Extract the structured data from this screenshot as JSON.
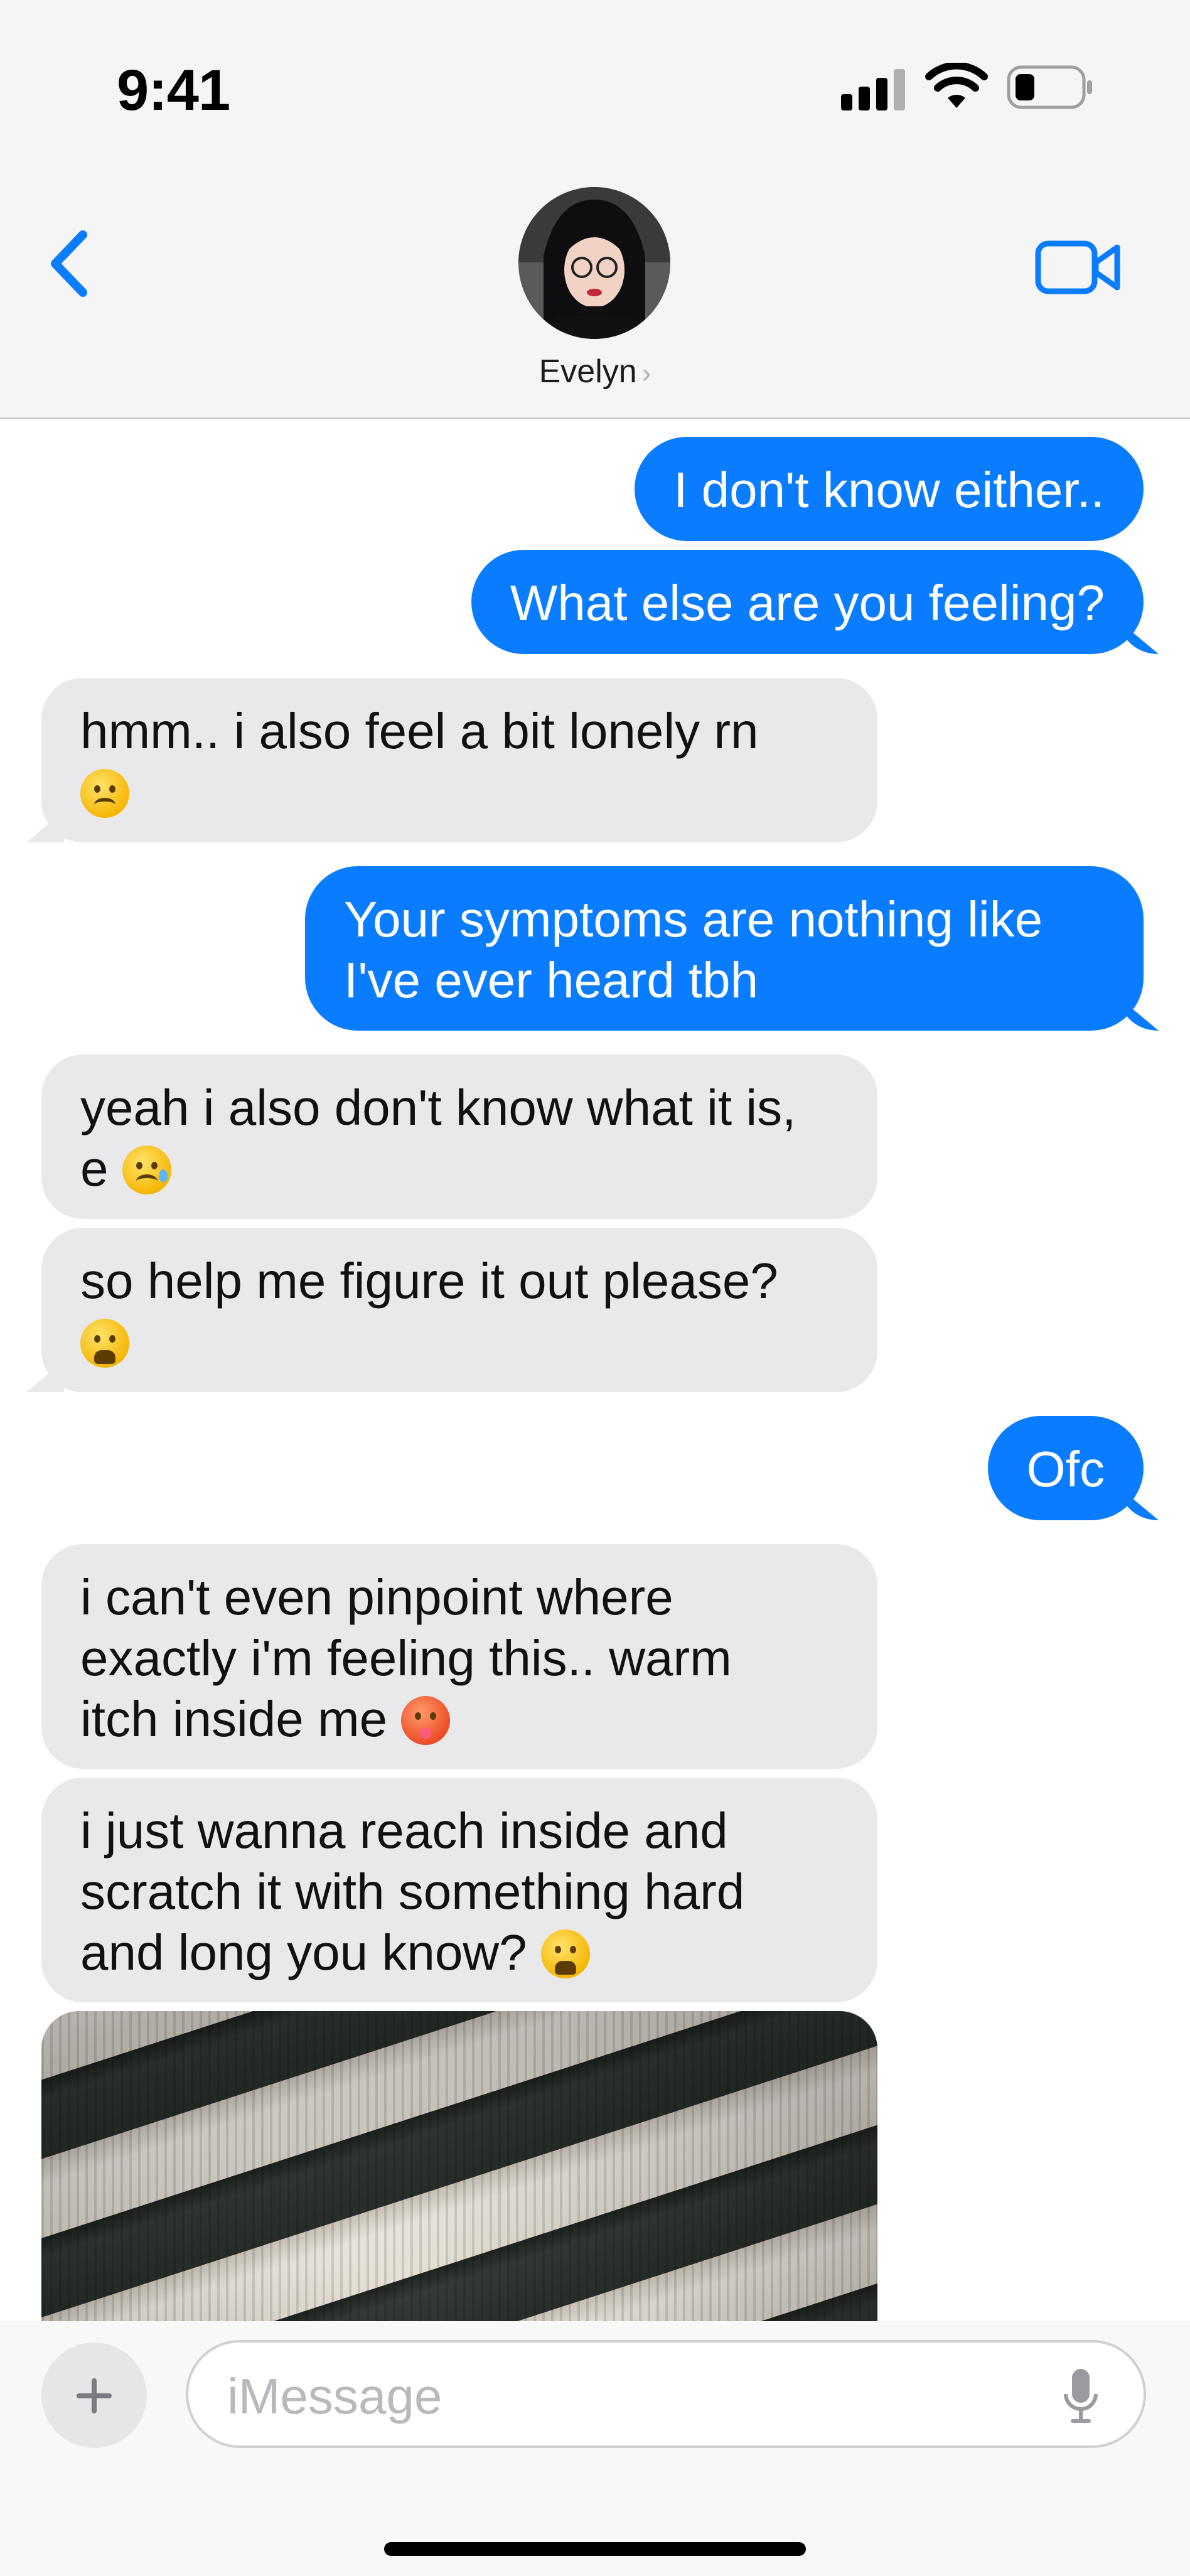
{
  "status_bar": {
    "time": "9:41"
  },
  "header": {
    "contact_name": "Evelyn",
    "name_chevron": "›"
  },
  "messages": [
    {
      "side": "out",
      "text": "I don't know either.."
    },
    {
      "side": "out",
      "text": "What else are you feeling?"
    },
    {
      "side": "in",
      "text": "hmm.. i also feel a bit lonely rn",
      "emoji": "frowning-face"
    },
    {
      "side": "out",
      "line1": "Your symptoms are nothing like",
      "line2": "I've ever heard tbh"
    },
    {
      "side": "in",
      "line1": "yeah i also don't know what it is,",
      "line2": "e",
      "emoji": "crying-face"
    },
    {
      "side": "in",
      "text": "so help me figure it out please?",
      "emoji": "weary-face"
    },
    {
      "side": "out",
      "text": "Ofc"
    },
    {
      "side": "in",
      "line1": "i can't even pinpoint where",
      "line2": "exactly i'm feeling this.. warm",
      "line3": "itch inside me",
      "emoji": "hot-face"
    },
    {
      "side": "in",
      "line1": "i just wanna reach inside and",
      "line2": "scratch it with something hard",
      "line3": "and long you know?",
      "emoji": "weary-face"
    },
    {
      "side": "in",
      "type": "photo",
      "description_icon": "striped-sweater-photo"
    }
  ],
  "input": {
    "placeholder": "iMessage"
  },
  "colors": {
    "outgoing": "#0a7cff",
    "incoming": "#e9e9eb",
    "accent": "#0a7cff"
  }
}
